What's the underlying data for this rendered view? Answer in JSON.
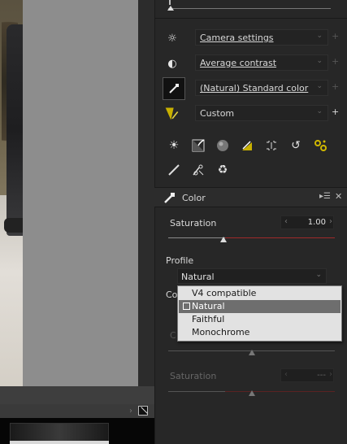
{
  "picture_control": {
    "rows": [
      {
        "icon": "brightness-icon",
        "label": "Camera settings",
        "underline": true,
        "plus_bright": false
      },
      {
        "icon": "contrast-icon",
        "label": "Average contrast",
        "underline": true,
        "plus_bright": false
      },
      {
        "icon": "picture-control-icon",
        "label": "(Natural) Standard color",
        "underline": true,
        "plus_bright": false
      },
      {
        "icon": "custom-adjust-icon",
        "label": "Custom",
        "underline": false,
        "plus_bright": true
      }
    ]
  },
  "tools": {
    "row1": [
      "exposure-icon",
      "tone-curve-icon",
      "color-ball-icon",
      "color-booster-icon",
      "crop-icon",
      "rotate-icon",
      "effects-icon"
    ],
    "row2": [
      "brush-icon",
      "retouch-icon",
      "recycle-icon"
    ]
  },
  "color_panel": {
    "title": "Color",
    "saturation_label": "Saturation",
    "saturation_value": "1.00",
    "saturation_fraction": 0.33,
    "profile_label": "Profile",
    "profile_selected": "Natural",
    "co_stub": "Co",
    "c_stub": "C",
    "saturation2_label": "Saturation",
    "saturation2_value": "---"
  },
  "profile_dropdown": {
    "options": [
      "V4 compatible",
      "Natural",
      "Faithful",
      "Monochrome"
    ],
    "selected_index": 1
  },
  "colors": {
    "panel_bg": "#272727",
    "viewer_gray": "#8d8d8d",
    "dropdown_bg": "#e2e2e2",
    "selected_bg": "#6e6e6e",
    "track_red": "#a02a2a"
  }
}
